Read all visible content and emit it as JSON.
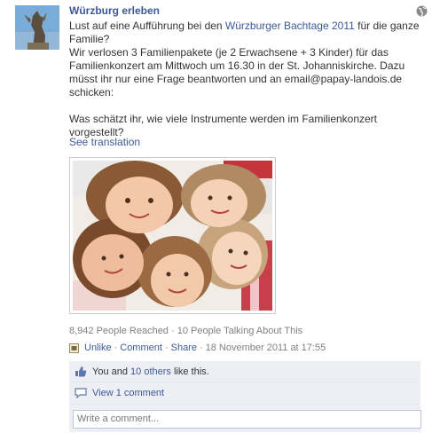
{
  "post": {
    "page_name": "Würzburg erleben",
    "line1_prefix": "Lust auf eine Aufführung bei den ",
    "line1_link": "Würzburger Bachtage 2011",
    "line1_suffix": " für die ganze Familie?",
    "line2": "Wir verlosen 3 Familienpakete (je 2 Erwachsene + 3 Kinder) für das Familienkonzert am Mittwoch um 16.30 in der St. Johanniskirche. Dazu müsst ihr nur eine Frage beantworten und an email@papay-landois.de schicken:",
    "line3": "Was schätzt ihr, wie viele Instrumente werden im Familienkonzert vorgestellt?",
    "see_translation": "See translation"
  },
  "stats": {
    "reach": "8,942 People Reached · 10 People Talking About This"
  },
  "actions": {
    "unlike": "Unlike",
    "comment": "Comment",
    "share": "Share",
    "timestamp": "18 November 2011 at 17:55",
    "sep": "·"
  },
  "likes": {
    "prefix": "You and ",
    "others": "10 others",
    "suffix": " like this."
  },
  "comments": {
    "view": "View 1 comment"
  },
  "comment_input": {
    "placeholder": "Write a comment..."
  },
  "colors": {
    "link": "#3b5998",
    "panel": "#edeff4"
  },
  "icons": {
    "globe": "globe-icon",
    "like": "thumbs-up-icon",
    "comment": "speech-bubble-icon",
    "activity": "activity-icon"
  }
}
